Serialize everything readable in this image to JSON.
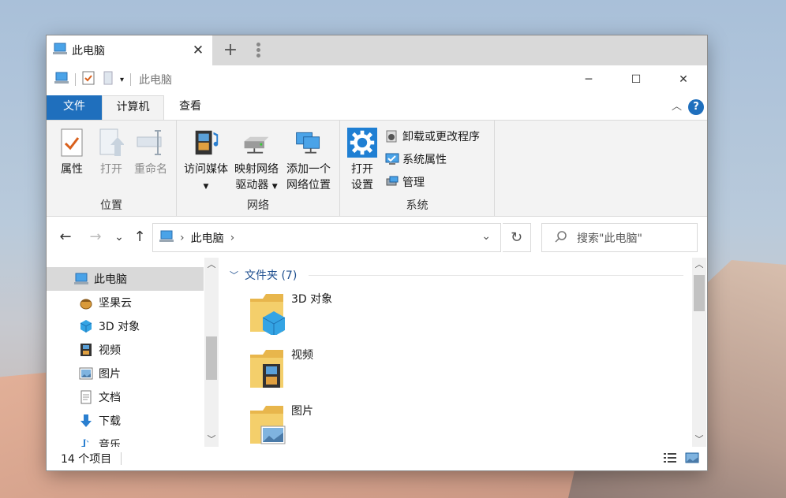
{
  "tab": {
    "title": "此电脑",
    "close": "✕",
    "new_tab": "+"
  },
  "titlebar": {
    "title": "此电脑",
    "minimize": "─",
    "maximize": "☐",
    "close": "✕"
  },
  "ribbon_tabs": {
    "file": "文件",
    "computer": "计算机",
    "view": "查看",
    "help": "?",
    "collapse": "︿"
  },
  "ribbon": {
    "location": {
      "name": "位置",
      "properties": "属性",
      "open": "打开",
      "rename": "重命名"
    },
    "network": {
      "name": "网络",
      "media_1": "访问媒体",
      "map_1": "映射网络",
      "map_2": "驱动器",
      "add_1": "添加一个",
      "add_2": "网络位置"
    },
    "system": {
      "name": "系统",
      "settings_1": "打开",
      "settings_2": "设置",
      "uninstall": "卸载或更改程序",
      "sysprops": "系统属性",
      "manage": "管理"
    }
  },
  "navigation": {
    "back": "←",
    "forward": "→",
    "recent": "⌄",
    "up": "↑",
    "address": "此电脑",
    "refresh": "↻",
    "search_placeholder": "搜索\"此电脑\""
  },
  "nav_pane": {
    "items": [
      {
        "label": "此电脑",
        "icon": "this-pc-icon",
        "selected": true
      },
      {
        "label": "坚果云",
        "icon": "nutstore-icon"
      },
      {
        "label": "3D 对象",
        "icon": "3d-objects-icon"
      },
      {
        "label": "视频",
        "icon": "video-icon"
      },
      {
        "label": "图片",
        "icon": "pictures-icon"
      },
      {
        "label": "文档",
        "icon": "documents-icon"
      },
      {
        "label": "下载",
        "icon": "download-icon"
      },
      {
        "label": "音乐",
        "icon": "music-icon"
      }
    ]
  },
  "content": {
    "section_title": "文件夹 (7)",
    "folders": [
      {
        "name": "3D 对象",
        "icon": "folder-3d-icon"
      },
      {
        "name": "视频",
        "icon": "folder-video-icon"
      },
      {
        "name": "图片",
        "icon": "folder-pictures-icon"
      }
    ]
  },
  "status": {
    "item_count": "14 个项目"
  },
  "colors": {
    "accent": "#1f6fbd",
    "selected_bg": "#d9d9d9",
    "folder": "#f4cf6b"
  }
}
